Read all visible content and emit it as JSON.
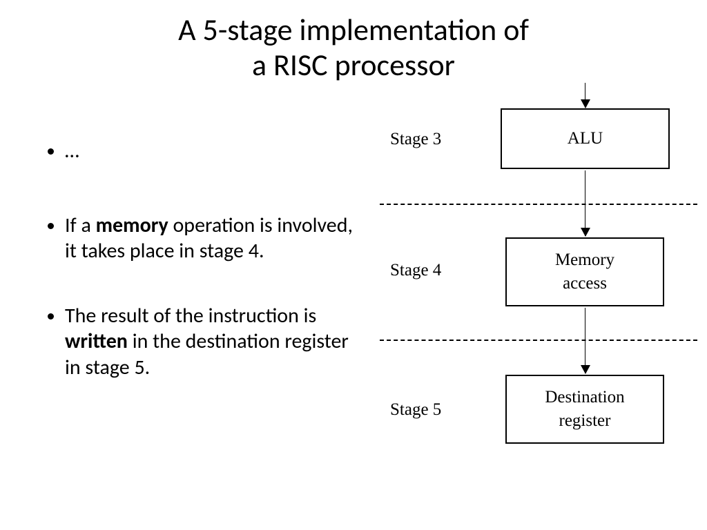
{
  "title": {
    "line1": "A 5-stage implementation of",
    "line2": "a RISC processor"
  },
  "bullets": {
    "item1": "…",
    "item2_pre": "If a ",
    "item2_bold": "memory",
    "item2_post": " operation is involved, it takes place in stage 4.",
    "item3_pre": "The result of the instruction is ",
    "item3_bold": "written",
    "item3_post": " in the destination register in stage 5."
  },
  "diagram": {
    "stage3": {
      "label": "Stage 3",
      "box": "ALU"
    },
    "stage4": {
      "label": "Stage 4",
      "box_l1": "Memory",
      "box_l2": "access"
    },
    "stage5": {
      "label": "Stage 5",
      "box_l1": "Destination",
      "box_l2": "register"
    }
  }
}
